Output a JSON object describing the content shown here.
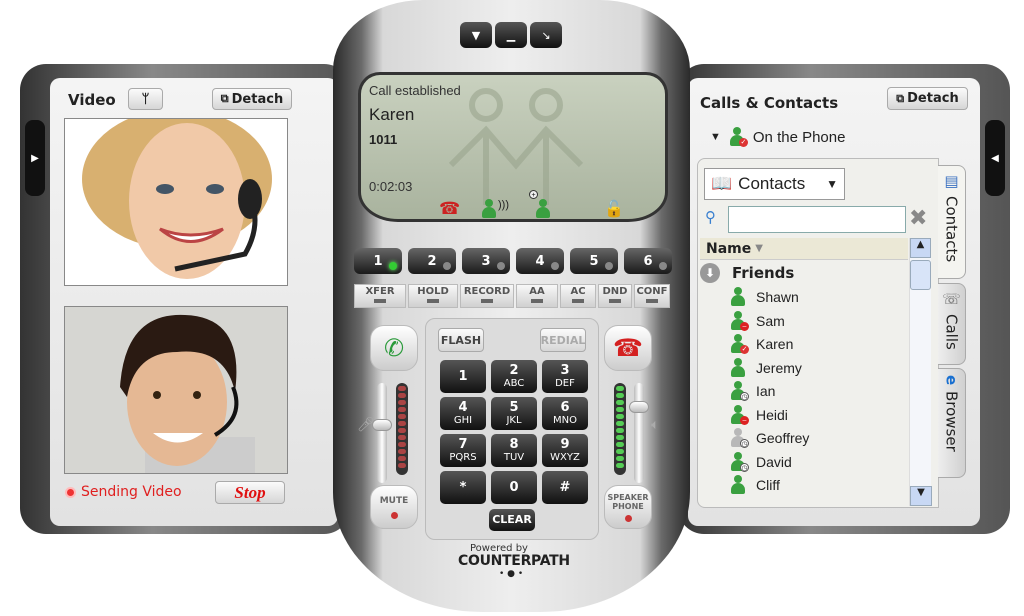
{
  "video_panel": {
    "title": "Video",
    "settings_icon": "wrench-icon",
    "detach_label": "Detach",
    "sending_status": "Sending Video",
    "stop_label": "Stop"
  },
  "phone": {
    "top_buttons": [
      "menu-down-icon",
      "minimize-icon",
      "close-icon"
    ],
    "lcd": {
      "status": "Call established",
      "name": "Karen",
      "number": "1011",
      "timer": "0:02:03",
      "icons": [
        "hangup-icon",
        "contact-speaking-icon",
        "add-contact-icon",
        "unlocked-padlock-icon"
      ]
    },
    "lines": [
      "1",
      "2",
      "3",
      "4",
      "5",
      "6"
    ],
    "active_line": "1",
    "functions": [
      "XFER",
      "HOLD",
      "RECORD",
      "AA",
      "AC",
      "DND",
      "CONF"
    ],
    "flash_label": "FLASH",
    "redial_label": "REDIAL",
    "keypad": [
      {
        "digit": "1",
        "letters": ""
      },
      {
        "digit": "2",
        "letters": "ABC"
      },
      {
        "digit": "3",
        "letters": "DEF"
      },
      {
        "digit": "4",
        "letters": "GHI"
      },
      {
        "digit": "5",
        "letters": "JKL"
      },
      {
        "digit": "6",
        "letters": "MNO"
      },
      {
        "digit": "7",
        "letters": "PQRS"
      },
      {
        "digit": "8",
        "letters": "TUV"
      },
      {
        "digit": "9",
        "letters": "WXYZ"
      },
      {
        "digit": "*",
        "letters": ""
      },
      {
        "digit": "0",
        "letters": ""
      },
      {
        "digit": "#",
        "letters": ""
      }
    ],
    "clear_label": "CLEAR",
    "mute_label": "MUTE",
    "speaker_label_1": "SPEAKER",
    "speaker_label_2": "PHONE",
    "powered_by": "Powered by",
    "brand": "COUNTERPATH",
    "colors": {
      "answer": "#2a9a3a",
      "hangup": "#d42020",
      "lcd": "#b9c2ad"
    }
  },
  "contacts_panel": {
    "title": "Calls & Contacts",
    "detach_label": "Detach",
    "presence": "On the Phone",
    "source_dropdown": "Contacts",
    "search_value": "",
    "column_header": "Name",
    "group": "Friends",
    "contacts": [
      {
        "name": "Shawn",
        "status": "available"
      },
      {
        "name": "Sam",
        "status": "busy"
      },
      {
        "name": "Karen",
        "status": "on-the-phone"
      },
      {
        "name": "Jeremy",
        "status": "available"
      },
      {
        "name": "Ian",
        "status": "away"
      },
      {
        "name": "Heidi",
        "status": "busy"
      },
      {
        "name": "Geoffrey",
        "status": "offline"
      },
      {
        "name": "David",
        "status": "away"
      },
      {
        "name": "Cliff",
        "status": "available"
      }
    ],
    "tabs": [
      "Contacts",
      "Calls",
      "Browser"
    ],
    "active_tab": "Contacts"
  }
}
